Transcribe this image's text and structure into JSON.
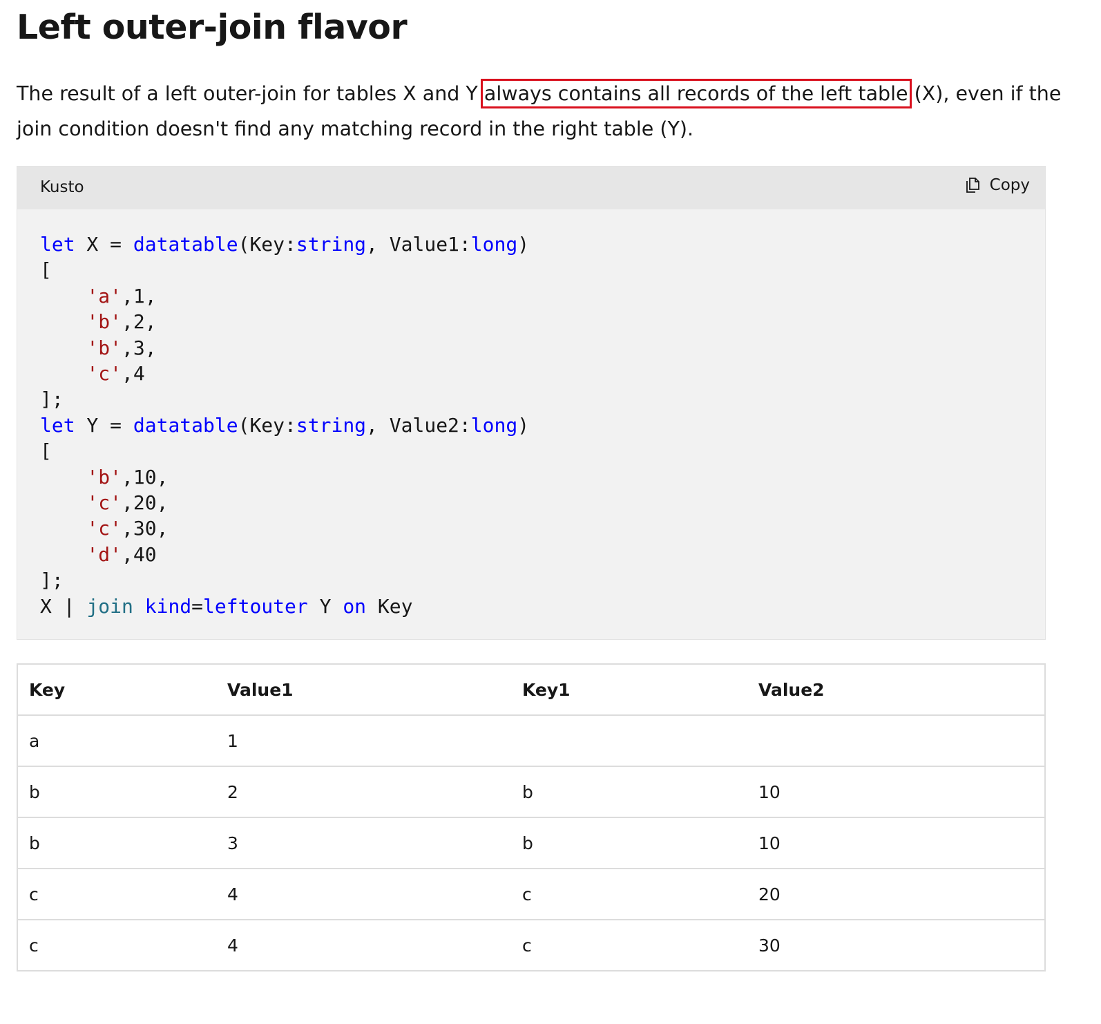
{
  "section": {
    "title": "Left outer-join flavor",
    "intro_before": "The result of a left outer-join for tables X and Y ",
    "intro_highlight": "always contains all records of the left table",
    "intro_after": " (X), even if the join condition doesn't find any matching record in the right table (Y)."
  },
  "code_block": {
    "language": "Kusto",
    "copy_label": "Copy",
    "copy_icon": "copy-icon",
    "syntax_colors": {
      "keyword": "#0101fd",
      "string": "#a31515",
      "operator": "#216f85",
      "text": "#171717"
    },
    "line1": {
      "kw": "let",
      "name": " X = ",
      "fn": "datatable",
      "a": "(Key:",
      "t1": "string",
      "b": ", Value1:",
      "t2": "long",
      "c": ")"
    },
    "open1": "[",
    "rows_x": [
      {
        "s": "'a'",
        "v": ",1,"
      },
      {
        "s": "'b'",
        "v": ",2,"
      },
      {
        "s": "'b'",
        "v": ",3,"
      },
      {
        "s": "'c'",
        "v": ",4"
      }
    ],
    "close1": "];",
    "line2": {
      "kw": "let",
      "name": " Y = ",
      "fn": "datatable",
      "a": "(Key:",
      "t1": "string",
      "b": ", Value2:",
      "t2": "long",
      "c": ")"
    },
    "open2": "[",
    "rows_y": [
      {
        "s": "'b'",
        "v": ",10,"
      },
      {
        "s": "'c'",
        "v": ",20,"
      },
      {
        "s": "'c'",
        "v": ",30,"
      },
      {
        "s": "'d'",
        "v": ",40"
      }
    ],
    "close2": "];",
    "query": {
      "x": "X | ",
      "op": "join",
      "sp": " ",
      "kind": "kind",
      "eq": "=",
      "val": "leftouter",
      "y": " Y ",
      "on": "on",
      "key": " Key"
    }
  },
  "result_table": {
    "headers": [
      "Key",
      "Value1",
      "Key1",
      "Value2"
    ],
    "rows": [
      [
        "a",
        "1",
        "",
        ""
      ],
      [
        "b",
        "2",
        "b",
        "10"
      ],
      [
        "b",
        "3",
        "b",
        "10"
      ],
      [
        "c",
        "4",
        "c",
        "20"
      ],
      [
        "c",
        "4",
        "c",
        "30"
      ]
    ]
  },
  "highlight_color": "#d9101d"
}
